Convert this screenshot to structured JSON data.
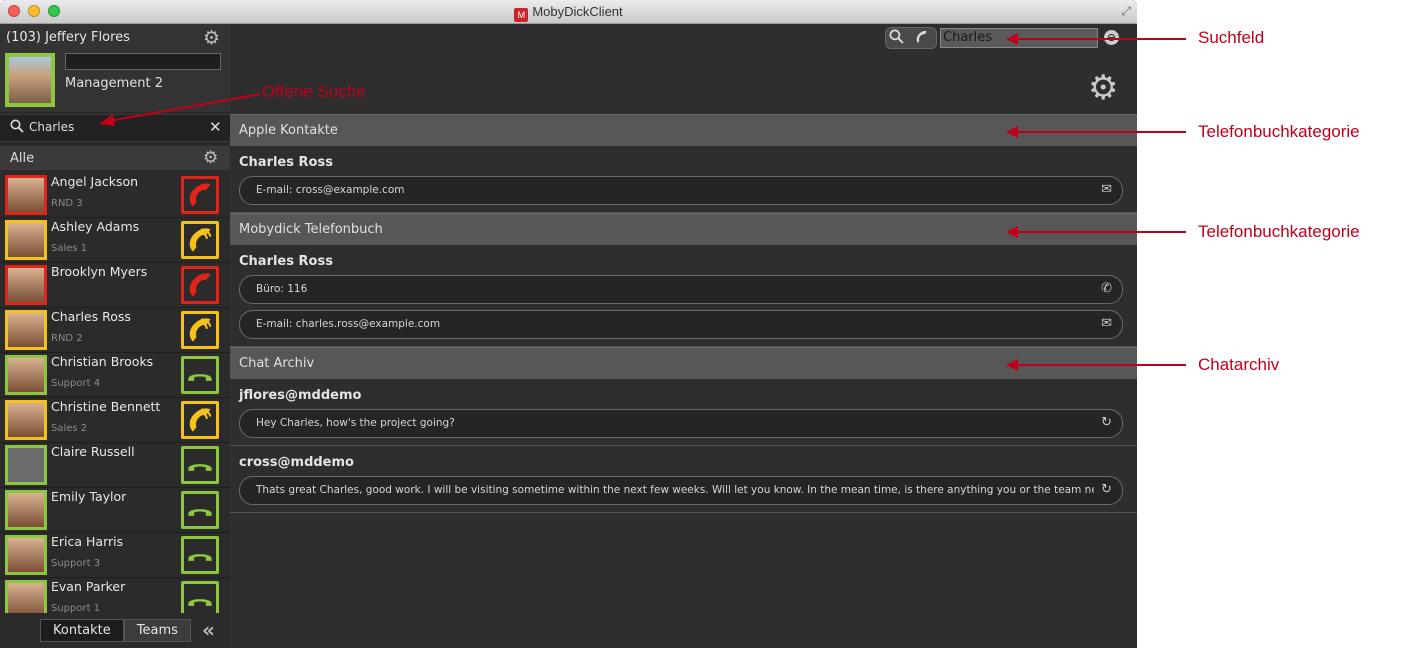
{
  "window": {
    "title": "MobyDickClient"
  },
  "user": {
    "name": "(103) Jeffery Flores",
    "group": "Management 2",
    "status": ""
  },
  "sidebar": {
    "search_query": "Charles",
    "filter_label": "Alle",
    "contacts": [
      {
        "name": "Angel Jackson",
        "group": "RND 3",
        "status": "red"
      },
      {
        "name": "Ashley Adams",
        "group": "Sales 1",
        "status": "yellow"
      },
      {
        "name": "Brooklyn Myers",
        "group": "",
        "status": "red"
      },
      {
        "name": "Charles Ross",
        "group": "RND 2",
        "status": "yellow"
      },
      {
        "name": "Christian Brooks",
        "group": "Support 4",
        "status": "green"
      },
      {
        "name": "Christine Bennett",
        "group": "Sales 2",
        "status": "yellow"
      },
      {
        "name": "Claire Russell",
        "group": "",
        "status": "green"
      },
      {
        "name": "Emily Taylor",
        "group": "",
        "status": "green"
      },
      {
        "name": "Erica Harris",
        "group": "Support 3",
        "status": "green"
      },
      {
        "name": "Evan Parker",
        "group": "Support 1",
        "status": "green"
      }
    ],
    "tabs": [
      "Kontakte",
      "Teams"
    ]
  },
  "main": {
    "search_value": "Charles",
    "sections": [
      {
        "title": "Apple Kontakte",
        "entries": [
          {
            "name": "Charles Ross",
            "items": [
              {
                "text": "E-mail: cross@example.com",
                "icon": "mail-icon"
              }
            ]
          }
        ]
      },
      {
        "title": "Mobydick Telefonbuch",
        "entries": [
          {
            "name": "Charles Ross",
            "items": [
              {
                "text": "Büro: 116",
                "icon": "phone-icon"
              },
              {
                "text": "E-mail: charles.ross@example.com",
                "icon": "mail-icon"
              }
            ]
          }
        ]
      },
      {
        "title": "Chat Archiv",
        "entries": [
          {
            "name": "jflores@mddemo",
            "items": [
              {
                "text": "Hey Charles, how's the project going?",
                "icon": "chat-history-icon"
              }
            ]
          },
          {
            "name": "cross@mddemo",
            "items": [
              {
                "text": "Thats great Charles, good work. I will be visiting sometime within the next few weeks. Will let you know. In the mean time, is there anything you or the team need?",
                "icon": "chat-history-icon"
              }
            ]
          }
        ]
      }
    ]
  },
  "annotations": {
    "suchfeld": "Suchfeld",
    "offene_suche": "Offene Suche",
    "kategorie1": "Telefonbuchkategorie",
    "kategorie2": "Telefonbuchkategorie",
    "chatarchiv": "Chatarchiv"
  },
  "colors": {
    "status_red": "#e2231a",
    "status_yellow": "#f4c21b",
    "status_green": "#8dc63f",
    "annotation": "#c0001a"
  }
}
